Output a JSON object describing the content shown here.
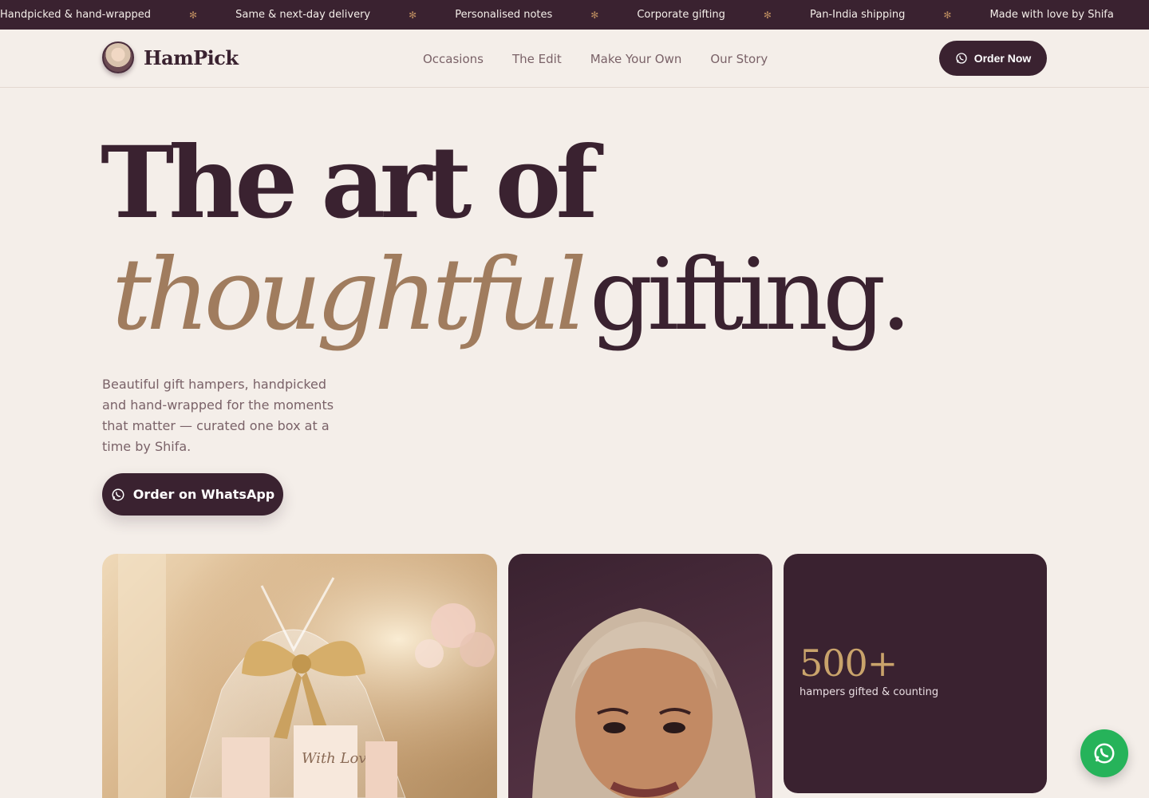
{
  "marquee": {
    "items": [
      "Handpicked & hand-wrapped",
      "Same & next-day delivery",
      "Personalised notes",
      "Corporate gifting",
      "Pan-India shipping",
      "Made with love by Shifa"
    ],
    "separator_glyph": "✻"
  },
  "header": {
    "brand": "HamPick",
    "nav": [
      "Occasions",
      "The Edit",
      "Make Your Own",
      "Our Story"
    ],
    "order_now_label": "Order Now"
  },
  "hero": {
    "line1": "The art of",
    "line2_emphasis": "thoughtful",
    "line2_word": "gifting.",
    "description": "Beautiful gift hampers, handpicked and hand-wrapped for the moments that matter — curated one box at a time by Shifa.",
    "cta_label": "Order on WhatsApp"
  },
  "stat": {
    "value": "500+",
    "label": "hampers gifted & counting"
  },
  "hamper_card": {
    "ribbon_note": "With Love"
  },
  "icons": {
    "cta": "whatsapp-icon",
    "order_now": "whatsapp-icon",
    "fab": "whatsapp-icon"
  },
  "colors": {
    "brand_plum": "#3a2230",
    "accent_tan": "#a07c5e",
    "gold": "#c9a36b",
    "background": "#f4eee9",
    "whatsapp_green": "#26b35a"
  }
}
